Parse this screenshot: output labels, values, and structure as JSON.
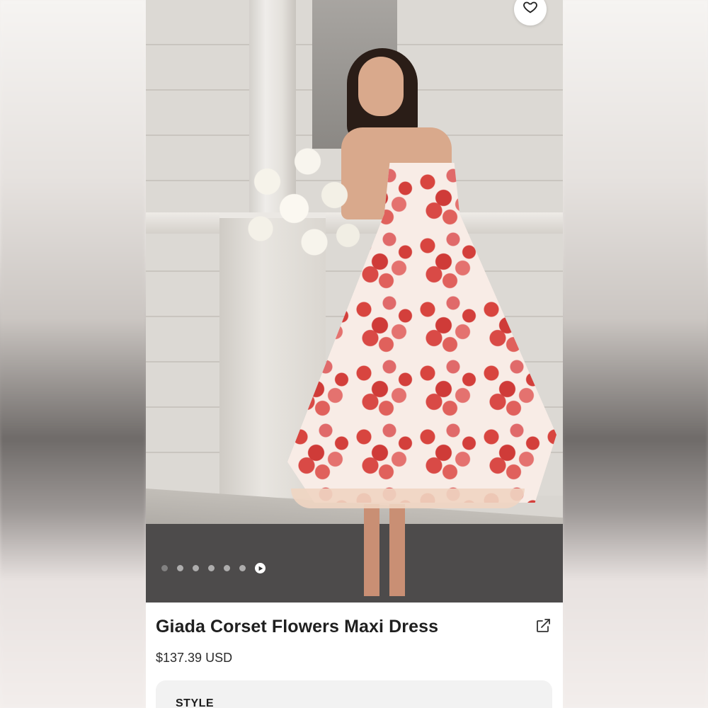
{
  "product": {
    "title": "Giada Corset Flowers Maxi Dress",
    "price": "$137.39 USD"
  },
  "gallery": {
    "image_alt": "Model wearing floral corset maxi dress holding white roses",
    "dot_count": 6,
    "active_index": 6
  },
  "icons": {
    "favorite": "heart-icon",
    "share": "external-link-icon",
    "play": "play-icon"
  },
  "sections": {
    "style_label": "STYLE"
  },
  "colors": {
    "title": "#1f1f1f",
    "card_bg": "#f2f2f2"
  }
}
